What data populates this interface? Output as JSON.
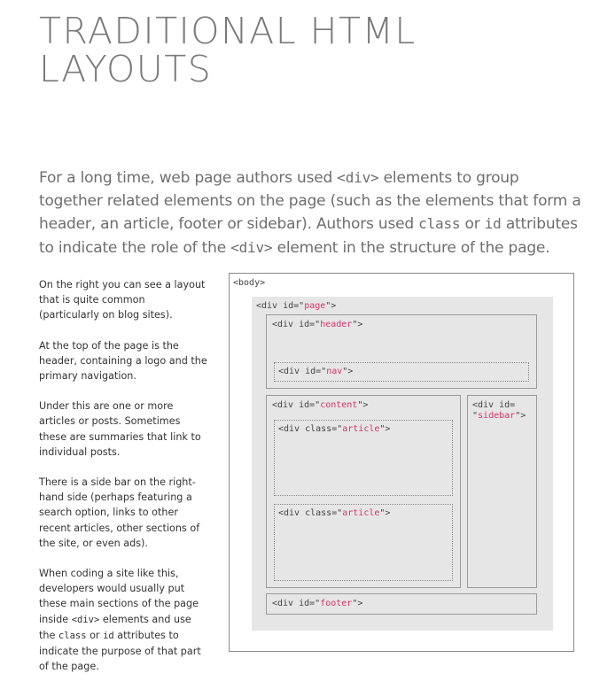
{
  "title": {
    "line1": "TRADITIONAL HTML",
    "line2": "LAYOUTS"
  },
  "intro": {
    "t1": "For a long time, web page authors used ",
    "c1": "<div>",
    "t2": " elements to group together related elements on the page (such as the elements that form a header, an article, footer or sidebar). Authors used ",
    "c2": "class",
    "t3": " or ",
    "c3": "id",
    "t4": " attributes to indicate the role of the ",
    "c4": "<div>",
    "t5": " element in the structure of the page."
  },
  "side": {
    "p1": "On the right you can see a layout that is quite common (particularly on blog sites).",
    "p2": "At the top of the page is the header, containing a logo and the primary navigation.",
    "p3": "Under this are one or more articles or posts. Sometimes these are summaries that link to individual posts.",
    "p4": "There is a side bar on the right-hand side (perhaps featuring a search option, links to other recent articles, other sections of the site, or even ads).",
    "p5a": "When coding a site like this, developers would usually put these main sections of the page inside ",
    "p5b": "<div>",
    "p5c": " elements and use the ",
    "p5d": "class",
    "p5e": " or ",
    "p5f": "id",
    "p5g": " attributes to indicate the purpose of that part of the page."
  },
  "diagram": {
    "body": "<body>",
    "page_pre": "<div id=\"",
    "page_val": "page",
    "page_post": "\">",
    "header_pre": "<div id=\"",
    "header_val": "header",
    "header_post": "\">",
    "nav_pre": "<div id=\"",
    "nav_val": "nav",
    "nav_post": "\">",
    "content_pre": "<div id=\"",
    "content_val": "content",
    "content_post": "\">",
    "sidebar_pre": "<div id=",
    "sidebar_q1": "\"",
    "sidebar_val": "sidebar",
    "sidebar_post": "\">",
    "article1_pre": "<div class=\"",
    "article1_val": "article",
    "article1_post": "\">",
    "article2_pre": "<div class=\"",
    "article2_val": "article",
    "article2_post": "\">",
    "footer_pre": "<div id=\"",
    "footer_val": "footer",
    "footer_post": "\">"
  },
  "colors": {
    "highlight": "#d6336c",
    "title": "#7a7a7a",
    "page_bg": "#e6e6e6"
  }
}
